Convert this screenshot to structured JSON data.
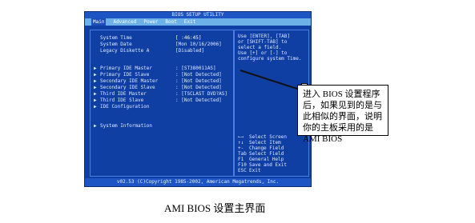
{
  "bios": {
    "title": "BIOS SETUP UTILITY",
    "menu": [
      {
        "label": "Main",
        "active": true
      },
      {
        "label": "Advanced",
        "active": false
      },
      {
        "label": "Power",
        "active": false
      },
      {
        "label": "Boot",
        "active": false
      },
      {
        "label": "Exit",
        "active": false
      }
    ],
    "main_rows": [
      {
        "label": "System Time",
        "value": "[ :46:45]",
        "arrow": ""
      },
      {
        "label": "System Date",
        "value": "[Mon 10/16/2006]",
        "arrow": ""
      },
      {
        "label": "Legacy Diskette A",
        "value": "[Disabled]",
        "arrow": ""
      },
      {
        "label": "Primary IDE Master",
        "value": ": [ST380011AS]",
        "arrow": "▶"
      },
      {
        "label": "Primary IDE Slave",
        "value": ": [Not Detected]",
        "arrow": "▶"
      },
      {
        "label": "Secondary IDE Master",
        "value": ": [Not Detected]",
        "arrow": "▶"
      },
      {
        "label": "Secondary IDE Slave",
        "value": ": [Not Detected]",
        "arrow": "▶"
      },
      {
        "label": "Third IDE Master",
        "value": ": [TSCLAST DVD?AS]",
        "arrow": "▶"
      },
      {
        "label": "Third IDE Slave",
        "value": ": [Not Detected]",
        "arrow": "▶"
      },
      {
        "label": "IDE Configuration",
        "value": "",
        "arrow": "▶"
      },
      {
        "label": "System Information",
        "value": "",
        "arrow": "▶"
      }
    ],
    "help_text": [
      "Use [ENTER], [TAB]",
      "or [SHIFT-TAB] to",
      "select a field.",
      "",
      "Use [+] or [-] to",
      "configure system Time."
    ],
    "keys": [
      {
        "k": "←→",
        "d": "Select Screen"
      },
      {
        "k": "↑↓",
        "d": "Select Item"
      },
      {
        "k": "+-",
        "d": "Change Field"
      },
      {
        "k": "Tab",
        "d": "Select Field"
      },
      {
        "k": "F1",
        "d": "General Help"
      },
      {
        "k": "F10",
        "d": "Save and Exit"
      },
      {
        "k": "ESC",
        "d": "Exit"
      }
    ],
    "footer": "v02.53 (C)Copyright 1985-2002, American Megatrends, Inc."
  },
  "annotation": {
    "callout_text": "进入 BIOS 设置程序后，如果见到的是与此相似的界面，说明你的主板采用的是 AMI BIOS",
    "caption": "AMI BIOS 设置主界面"
  },
  "colors": {
    "bios_bg": "#0f3fa2",
    "menu_bar": "#6cb2e8",
    "border": "#4b7ee5",
    "text": "#dfe9ff"
  }
}
